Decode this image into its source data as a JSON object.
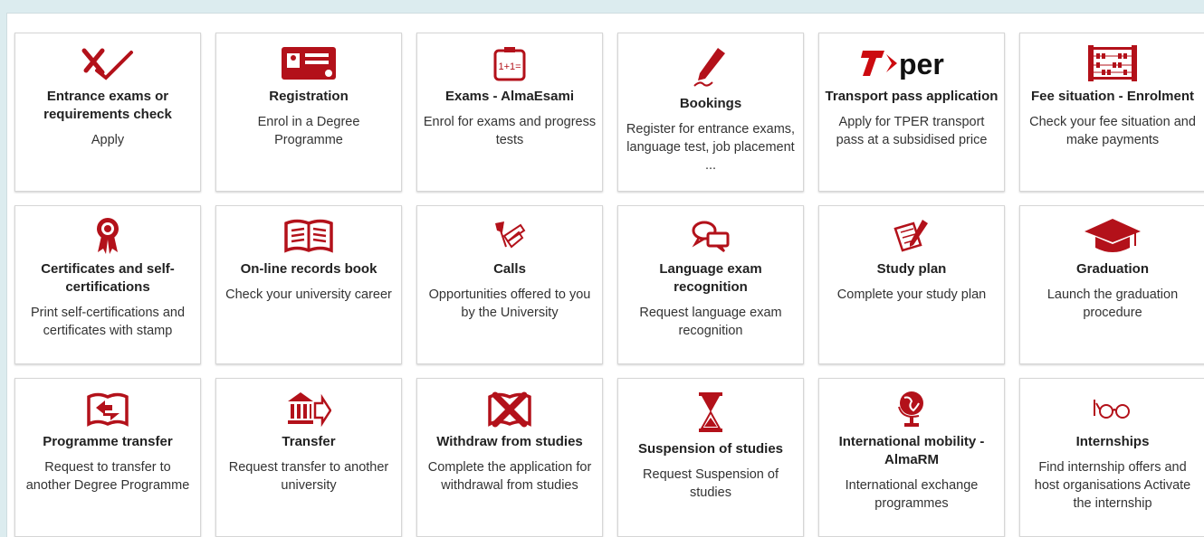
{
  "colors": {
    "accent": "#b3111a",
    "background": "#dcecef"
  },
  "tiles": [
    {
      "icon": "check-cross-icon",
      "title": "Entrance exams or requirements check",
      "desc": "Apply"
    },
    {
      "icon": "id-card-icon",
      "title": "Registration",
      "desc": "Enrol in a Degree Programme"
    },
    {
      "icon": "exam-paper-icon",
      "title": "Exams - AlmaEsami",
      "desc": "Enrol for exams and progress tests"
    },
    {
      "icon": "pen-writing-icon",
      "title": "Bookings",
      "desc": "Register for entrance exams, language test, job placement ..."
    },
    {
      "icon": "tper-logo-icon",
      "title": "Transport pass application",
      "desc": "Apply for TPER transport pass at a subsidised price",
      "logo_text": "T per"
    },
    {
      "icon": "abacus-icon",
      "title": "Fee situation - Enrolment",
      "desc": "Check your fee situation and make payments"
    },
    {
      "icon": "award-rosette-icon",
      "title": "Certificates and self-certifications",
      "desc": "Print self-certifications and certificates with stamp"
    },
    {
      "icon": "open-book-icon",
      "title": "On-line records book",
      "desc": "Check your university career"
    },
    {
      "icon": "pushpin-notes-icon",
      "title": "Calls",
      "desc": "Opportunities offered to you by the University"
    },
    {
      "icon": "speech-bubbles-icon",
      "title": "Language exam recognition",
      "desc": "Request language exam recognition"
    },
    {
      "icon": "study-plan-icon",
      "title": "Study plan",
      "desc": "Complete your study plan"
    },
    {
      "icon": "graduation-cap-icon",
      "title": "Graduation",
      "desc": "Launch the graduation procedure"
    },
    {
      "icon": "book-arrows-icon",
      "title": "Programme transfer",
      "desc": "Request to transfer to another Degree Programme"
    },
    {
      "icon": "building-arrow-icon",
      "title": "Transfer",
      "desc": "Request transfer to another university"
    },
    {
      "icon": "book-x-icon",
      "title": "Withdraw from studies",
      "desc": "Complete the application for withdrawal from studies"
    },
    {
      "icon": "hourglass-icon",
      "title": "Suspension of studies",
      "desc": "Request Suspension of studies"
    },
    {
      "icon": "globe-icon",
      "title": "International mobility - AlmaRM",
      "desc": "International exchange programmes"
    },
    {
      "icon": "glasses-icon",
      "title": "Internships",
      "desc": "Find internship offers and host organisations Activate the internship"
    }
  ]
}
